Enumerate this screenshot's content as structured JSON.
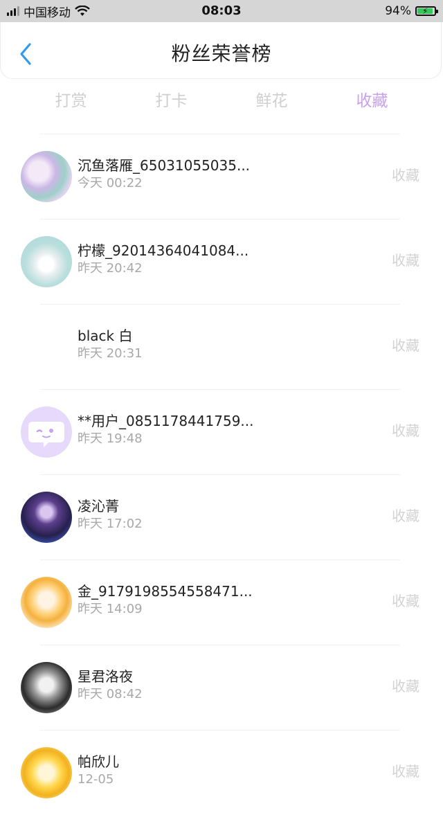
{
  "status": {
    "carrier": "中国移动",
    "time": "08:03",
    "battery": "94%",
    "battery_level": 0.94,
    "icons": [
      "signal-icon",
      "wifi-icon",
      "battery-charging-icon"
    ]
  },
  "header": {
    "title": "粉丝荣誉榜",
    "back_icon": "chevron-left-icon",
    "accent": "#2f9bea"
  },
  "tabs": [
    {
      "label": "打赏",
      "active": false
    },
    {
      "label": "打卡",
      "active": false
    },
    {
      "label": "鲜花",
      "active": false
    },
    {
      "label": "收藏",
      "active": true
    }
  ],
  "colors": {
    "tab_active": "#c7a0ef",
    "tab_inactive": "#cfcfcf",
    "action": "#d2d2d2"
  },
  "fans": [
    {
      "name": "沉鱼落雁_65031055035...",
      "time": "今天 00:22",
      "action": "收藏"
    },
    {
      "name": "柠檬_92014364041084...",
      "time": "昨天 20:42",
      "action": "收藏"
    },
    {
      "name": "black 白",
      "time": "昨天 20:31",
      "action": "收藏"
    },
    {
      "name": "**用户_0851178441759...",
      "time": "昨天 19:48",
      "action": "收藏"
    },
    {
      "name": "凌沁菁",
      "time": "昨天 17:02",
      "action": "收藏"
    },
    {
      "name": "金_9179198554558471...",
      "time": "昨天 14:09",
      "action": "收藏"
    },
    {
      "name": "星君洛夜",
      "time": "昨天 08:42",
      "action": "收藏"
    },
    {
      "name": "帕欣儿",
      "time": "12-05",
      "action": "收藏"
    }
  ]
}
